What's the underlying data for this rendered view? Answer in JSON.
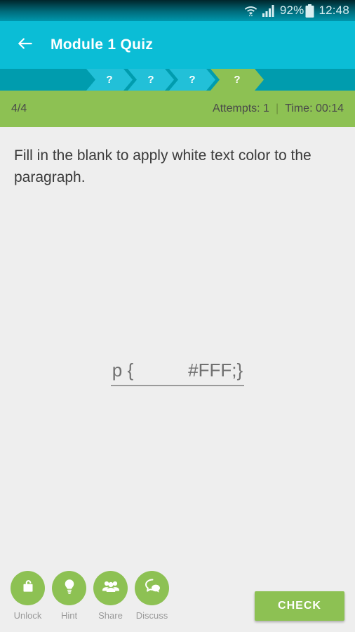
{
  "status_bar": {
    "wifi_icon": "wifi-icon",
    "signal_icon": "signal-bars-icon",
    "battery_percent": "92%",
    "battery_icon": "battery-icon",
    "time": "12:48"
  },
  "app_bar": {
    "back_icon": "back-arrow-icon",
    "title": "Module 1 Quiz"
  },
  "progress": {
    "steps": [
      {
        "label": "?",
        "state": "done"
      },
      {
        "label": "?",
        "state": "done"
      },
      {
        "label": "?",
        "state": "done"
      },
      {
        "label": "?",
        "state": "active"
      }
    ]
  },
  "meta": {
    "score": "4/4",
    "attempts": "Attempts: 1",
    "separator": "|",
    "time": "Time: 00:14"
  },
  "question": {
    "text": "Fill in the blank to apply white text color to the paragraph."
  },
  "answer": {
    "prefix": "p {",
    "blank": "",
    "suffix": "#FFF;}"
  },
  "actions": [
    {
      "label": "Unlock",
      "icon": "padlock-icon"
    },
    {
      "label": "Hint",
      "icon": "lightbulb-icon"
    },
    {
      "label": "Share",
      "icon": "people-group-icon"
    },
    {
      "label": "Discuss",
      "icon": "speech-bubbles-icon"
    }
  ],
  "check_button": {
    "label": "CHECK"
  },
  "colors": {
    "accent_cyan": "#0bbdd6",
    "accent_green": "#8dc153",
    "chevron_track": "#009cae",
    "chevron_done": "#22c0d8",
    "content_bg": "#eeeeee",
    "text_dark": "#3a3a3a"
  }
}
